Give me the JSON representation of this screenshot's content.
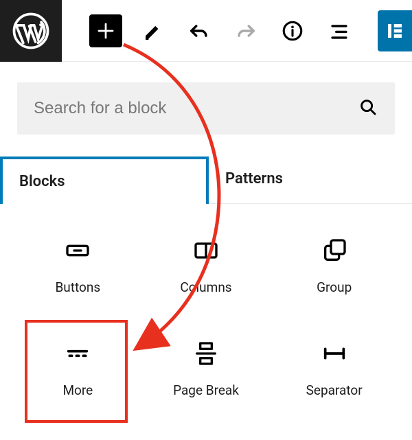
{
  "toolbar": {
    "add_tooltip": "Add block",
    "edit_tooltip": "Tools",
    "undo_tooltip": "Undo",
    "redo_tooltip": "Redo",
    "info_tooltip": "Details",
    "outline_tooltip": "List View"
  },
  "search": {
    "placeholder": "Search for a block"
  },
  "tabs": {
    "blocks": "Blocks",
    "patterns": "Patterns"
  },
  "blocks": {
    "buttons": "Buttons",
    "columns": "Columns",
    "group": "Group",
    "more": "More",
    "pagebreak": "Page Break",
    "separator": "Separator"
  },
  "annotation": {
    "highlight_target": "more-block",
    "arrow_from": "add-block-button",
    "arrow_to": "more-block"
  }
}
